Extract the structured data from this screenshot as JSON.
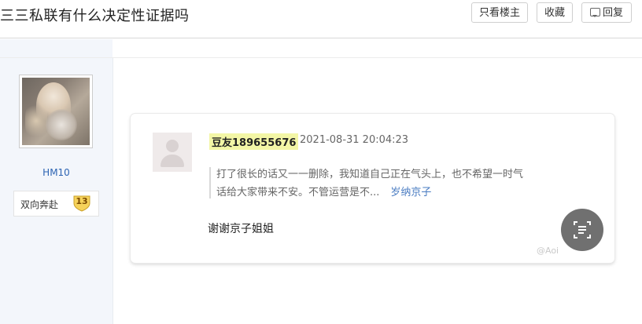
{
  "header": {
    "title": "三三私联有什么决定性证据吗",
    "btn_only_owner": "只看楼主",
    "btn_collect": "收藏",
    "btn_reply": "回复"
  },
  "sidebar": {
    "username": "HM10",
    "badge_text": "双向奔赴",
    "badge_level": "13"
  },
  "card": {
    "user": "豆友189655676",
    "time": "2021-08-31 20:04:23",
    "quote_line1": "打了很长的话又一一删除，我知道自己正在气头上，也不希望一时气",
    "quote_line2": "话给大家带来不安。不管运营是不...",
    "quote_link": "岁纳京子",
    "reply": "谢谢京子姐姐",
    "watermark": "@Aoi"
  },
  "colors": {
    "sidebar_bg": "#f3f6fb",
    "username": "#2d64b3",
    "highlight": "#f3f6a6",
    "link": "#4a7cc2"
  }
}
